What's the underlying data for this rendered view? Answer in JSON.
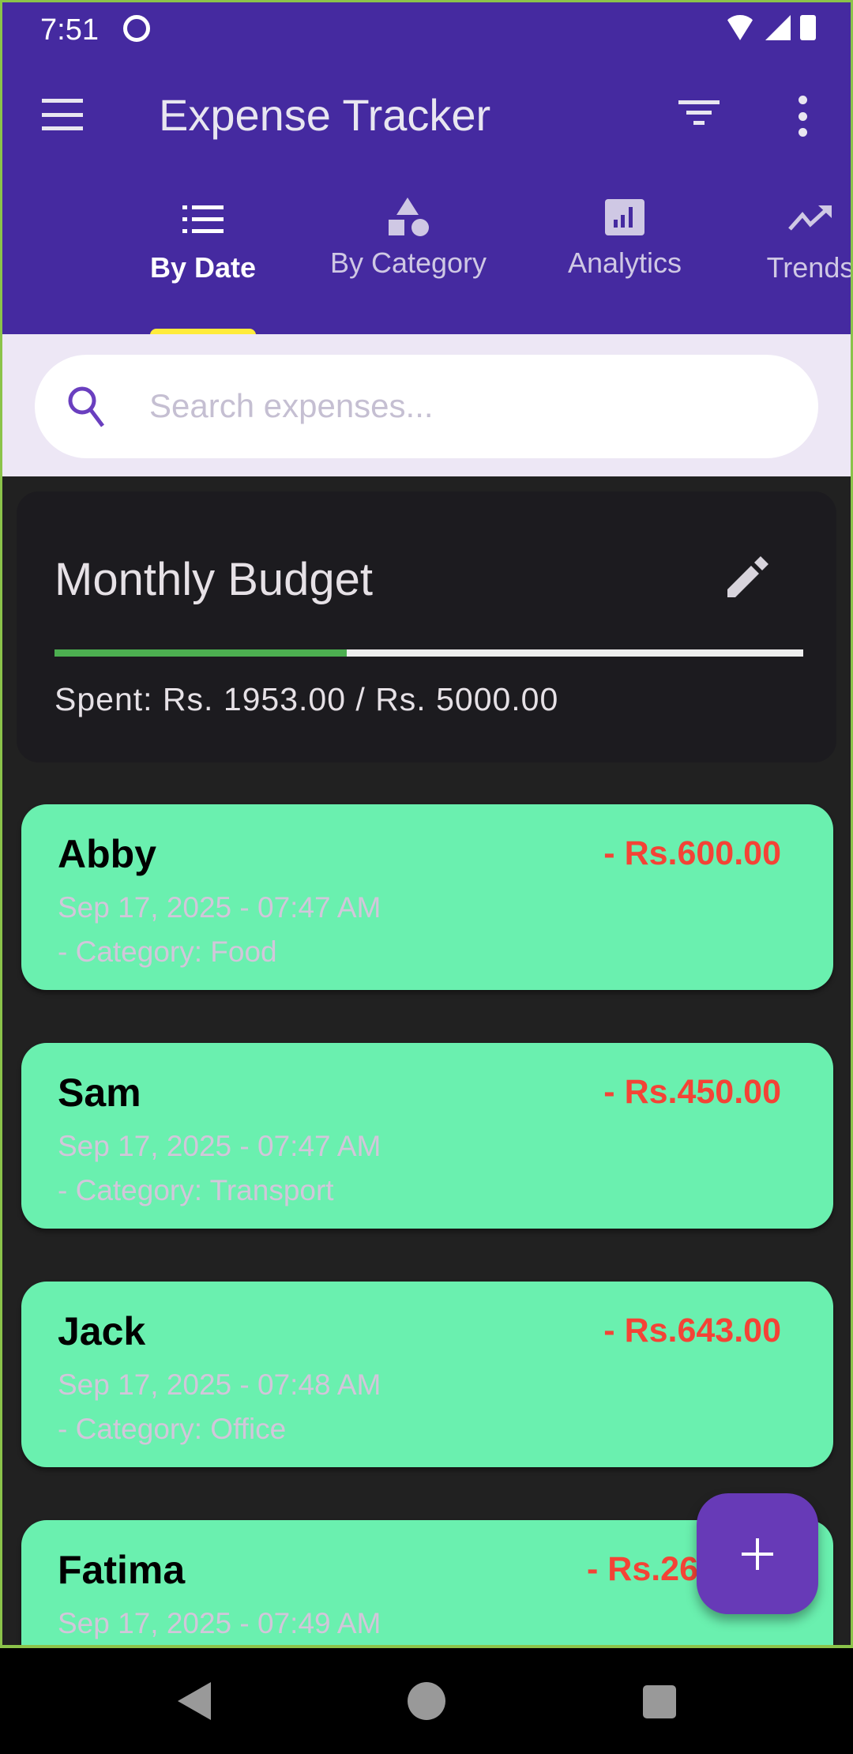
{
  "status_bar": {
    "time": "7:51"
  },
  "app_bar": {
    "title": "Expense Tracker"
  },
  "tabs": [
    {
      "label": "By Date",
      "icon": "list-icon",
      "active": true
    },
    {
      "label": "By Category",
      "icon": "category-shapes-icon",
      "active": false
    },
    {
      "label": "Analytics",
      "icon": "bar-chart-icon",
      "active": false
    },
    {
      "label": "Trends",
      "icon": "trending-up-icon",
      "active": false
    }
  ],
  "search": {
    "placeholder": "Search expenses...",
    "value": ""
  },
  "budget": {
    "title": "Monthly Budget",
    "spent_text": "Spent: Rs. 1953.00 / Rs. 5000.00",
    "spent": 1953,
    "total": 5000,
    "progress_percent": 39.06
  },
  "expenses": [
    {
      "name": "Abby",
      "amount": "- Rs.600.00",
      "date": "Sep 17, 2025 - 07:47 AM",
      "category": "- Category: Food"
    },
    {
      "name": "Sam",
      "amount": "- Rs.450.00",
      "date": "Sep 17, 2025 - 07:47 AM",
      "category": "- Category: Transport"
    },
    {
      "name": "Jack",
      "amount": "- Rs.643.00",
      "date": "Sep 17, 2025 - 07:48 AM",
      "category": "- Category: Office"
    },
    {
      "name": "Fatima",
      "amount": "- Rs.26",
      "date": "Sep 17, 2025 - 07:49 AM",
      "category": ""
    }
  ],
  "colors": {
    "primary": "#452aa0",
    "indicator": "#ffeb3b",
    "card": "#6af0af",
    "amount": "#f44336",
    "fab": "#673ab7",
    "progress": "#4caf50"
  }
}
